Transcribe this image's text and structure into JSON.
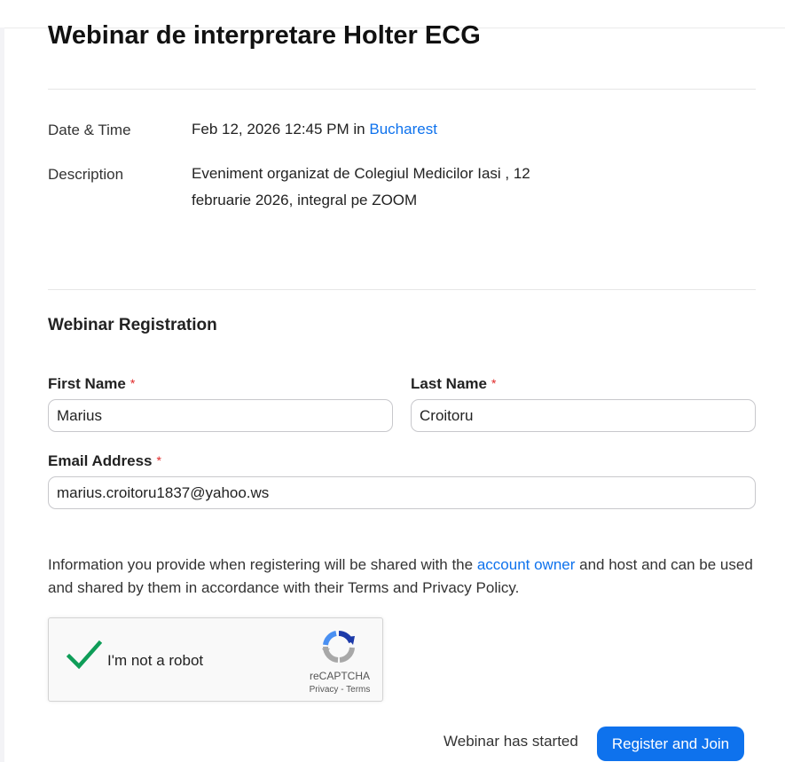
{
  "webinar": {
    "title": "Webinar de interpretare Holter ECG",
    "date_time_label": "Date & Time",
    "date_time_value": "Feb 12, 2026 12:45 PM in",
    "timezone_link": "Bucharest",
    "description_label": "Description",
    "description_line1": "Eveniment organizat de Colegiul Medicilor Iasi , 12",
    "description_line2": "februarie 2026, integral pe ZOOM"
  },
  "registration": {
    "heading": "Webinar Registration",
    "first_name_label": "First Name",
    "first_name_value": "Marius",
    "last_name_label": "Last Name",
    "last_name_value": "Croitoru",
    "email_label": "Email Address",
    "email_value": "marius.croitoru1837@yahoo.ws",
    "required_mark": "*"
  },
  "info": {
    "text_before": "Information you provide when registering will be shared with the",
    "link": "account owner",
    "text_after": "and host and can be used and shared by them in accordance with their Terms and Privacy Policy."
  },
  "recaptcha": {
    "label": "I'm not a robot",
    "brand": "reCAPTCHA",
    "privacy": "Privacy",
    "separator": "-",
    "terms": "Terms",
    "checked": true,
    "check_color": "#0f9d58"
  },
  "footer": {
    "status": "Webinar has started",
    "button": "Register and Join"
  },
  "colors": {
    "accent": "#0e72ed",
    "required": "#e02828"
  }
}
